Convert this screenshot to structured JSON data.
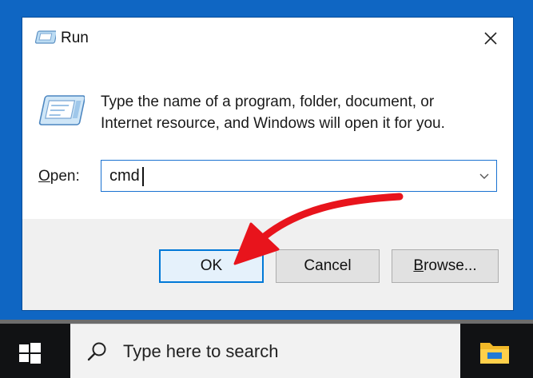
{
  "dialog": {
    "title": "Run",
    "description_line1": "Type the name of a program, folder, document, or",
    "description_line2": "Internet resource, and Windows will open it for you.",
    "open_label_prefix": "O",
    "open_label_rest": "pen:",
    "input_value": "cmd",
    "ok_label": "OK",
    "cancel_label": "Cancel",
    "browse_prefix": "B",
    "browse_rest": "rowse..."
  },
  "taskbar": {
    "search_placeholder": "Type here to search"
  },
  "icons": {
    "title": "run-icon",
    "big": "run-icon",
    "close": "close-icon",
    "dropdown": "chevron-down-icon",
    "start": "windows-logo-icon",
    "search": "search-icon",
    "explorer": "file-explorer-icon"
  },
  "colors": {
    "accent": "#0078d7",
    "frame": "#0f66c3",
    "annotation_arrow": "#e8141c"
  }
}
